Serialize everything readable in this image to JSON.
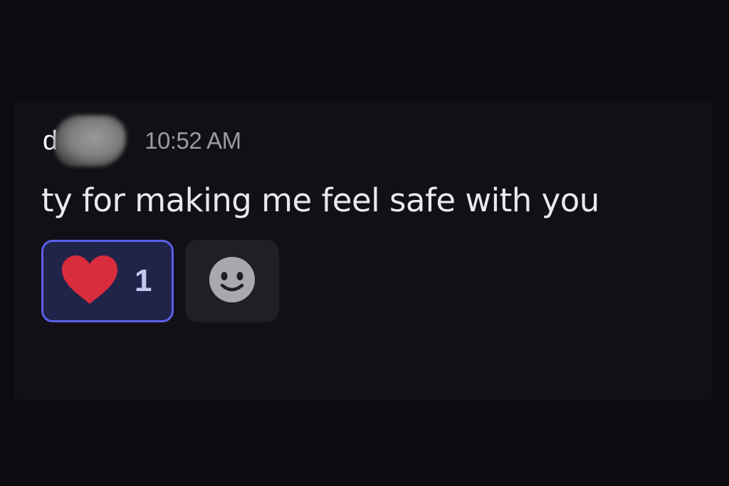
{
  "message": {
    "author": "d",
    "timestamp": "10:52 AM",
    "text": "ty for making me feel safe with you"
  },
  "reactions": [
    {
      "emoji": "heart-icon",
      "count": "1",
      "selected": true,
      "color": "#d92c3d"
    }
  ],
  "add_reaction": {
    "icon": "smiley-add-reaction-icon"
  },
  "colors": {
    "background": "#0c0b10",
    "panel": "#111016",
    "reaction_border": "#5b5fe8",
    "reaction_bg": "#212449",
    "timestamp": "#9a9aa3"
  }
}
